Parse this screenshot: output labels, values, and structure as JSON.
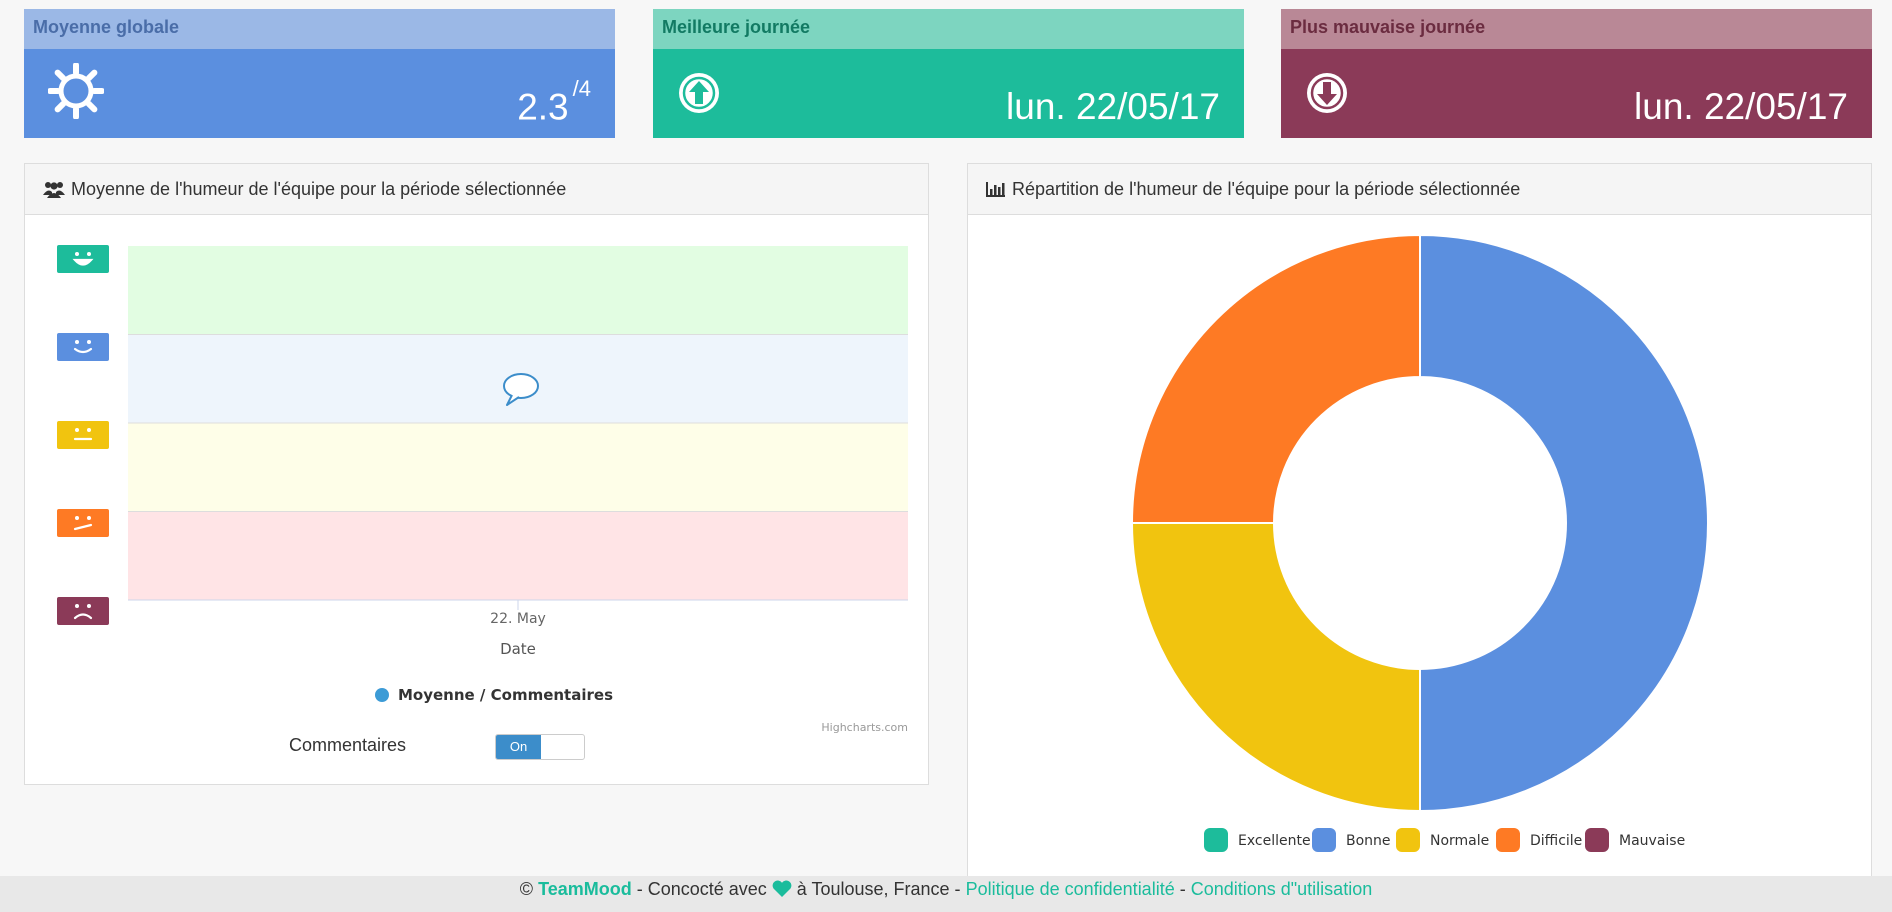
{
  "cards": [
    {
      "title": "Moyenne globale",
      "value": "2.3",
      "suffix": "/4",
      "icon": "sun-icon",
      "head_bg": "#9bb8e6",
      "head_fg": "#4a6da8",
      "body_bg": "#5b8fdf"
    },
    {
      "title": "Meilleure journée",
      "value": "lun. 22/05/17",
      "suffix": "",
      "icon": "arrow-up-circle-icon",
      "head_bg": "#7dd5c0",
      "head_fg": "#127a63",
      "body_bg": "#1dbc9b"
    },
    {
      "title": "Plus mauvaise journée",
      "value": "lun. 22/05/17",
      "suffix": "",
      "icon": "arrow-down-circle-icon",
      "head_bg": "#b98896",
      "head_fg": "#6b2c40",
      "body_bg": "#8b3a58"
    }
  ],
  "line_panel": {
    "title": "Moyenne de l'humeur de l'équipe pour la période sélectionnée",
    "icon": "users-icon",
    "x_tick": "22. May",
    "x_label": "Date",
    "legend": "Moyenne / Commentaires",
    "credit": "Highcharts.com",
    "comments_label": "Commentaires",
    "toggle_label": "On"
  },
  "pie_panel": {
    "title": "Répartition de l'humeur de l'équipe pour la période sélectionnée",
    "icon": "bar-chart-icon"
  },
  "chart_data": [
    {
      "type": "line",
      "x": [
        "22. May"
      ],
      "xlabel": "Date",
      "series": [
        {
          "name": "Moyenne / Commentaires",
          "values": []
        }
      ],
      "bands": [
        {
          "mood": "Excellente",
          "color": "#e2fde2"
        },
        {
          "mood": "Bonne",
          "color": "#eef5fc"
        },
        {
          "mood": "Normale",
          "color": "#fefee8"
        },
        {
          "mood": "Mauvaise",
          "color": "#ffe4e6"
        }
      ],
      "mood_icons": [
        {
          "mood": "Excellente",
          "color": "#1dbc9b",
          "face": "big-smile"
        },
        {
          "mood": "Bonne",
          "color": "#5b8fdf",
          "face": "smile"
        },
        {
          "mood": "Normale",
          "color": "#f1c40f",
          "face": "neutral"
        },
        {
          "mood": "Difficile",
          "color": "#fe7a24",
          "face": "skew"
        },
        {
          "mood": "Mauvaise",
          "color": "#8b3a58",
          "face": "sad"
        }
      ],
      "legend": "bottom-center",
      "grid": false
    },
    {
      "type": "pie",
      "donut": true,
      "slices": [
        {
          "name": "Excellente",
          "value": 0,
          "color": "#1dbc9b"
        },
        {
          "name": "Bonne",
          "value": 50,
          "color": "#5b8fdf"
        },
        {
          "name": "Normale",
          "value": 25,
          "color": "#f1c40f"
        },
        {
          "name": "Difficile",
          "value": 25,
          "color": "#fe7a24"
        },
        {
          "name": "Mauvaise",
          "value": 0,
          "color": "#8b3a58"
        }
      ],
      "legend": "bottom-center"
    }
  ],
  "footer": {
    "copyright": "©",
    "brand": "TeamMood",
    "text1": " - Concocté avec ",
    "text2": " à Toulouse, France - ",
    "privacy": "Politique de confidentialité",
    "sep": " - ",
    "terms": "Conditions d\"utilisation",
    "heart_color": "#1abc9c"
  }
}
